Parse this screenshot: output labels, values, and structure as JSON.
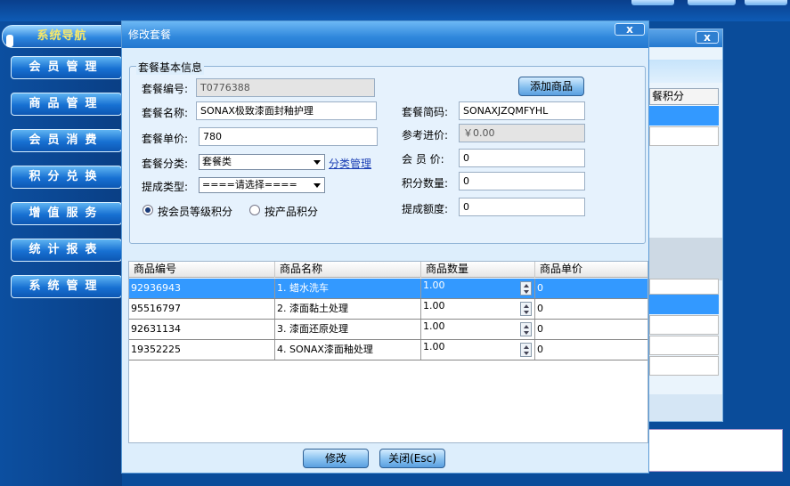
{
  "sidebar": {
    "header": "系统导航",
    "items": [
      {
        "label": "会员管理"
      },
      {
        "label": "商品管理"
      },
      {
        "label": "会员消费"
      },
      {
        "label": "积分兑换"
      },
      {
        "label": "增值服务"
      },
      {
        "label": "统计报表"
      },
      {
        "label": "系统管理"
      }
    ]
  },
  "background_window": {
    "close_glyph": "x",
    "column_header": "餐积分"
  },
  "dialog": {
    "title": "修改套餐",
    "close_glyph": "x",
    "section_title": "套餐基本信息",
    "fields": {
      "code_label": "套餐编号:",
      "code_value": "T0776388",
      "name_label": "套餐名称:",
      "name_value": "SONAX极致漆面封釉护理",
      "price_label": "套餐单价:",
      "price_value": "780",
      "category_label": "套餐分类:",
      "category_value": "套餐类",
      "category_link": "分类管理",
      "commission_type_label": "提成类型:",
      "commission_type_value": "====请选择====",
      "radio_member_level": "按会员等级积分",
      "radio_product": "按产品积分",
      "abbr_label": "套餐简码:",
      "abbr_value": "SONAXJZQMFYHL",
      "ref_price_label": "参考进价:",
      "ref_price_value": "￥0.00",
      "member_price_label": "会 员 价:",
      "member_price_value": "0",
      "points_label": "积分数量:",
      "points_value": "0",
      "commission_label": "提成额度:",
      "commission_value": "0"
    },
    "add_product_button": "添加商品",
    "table": {
      "columns": [
        "商品编号",
        "商品名称",
        "商品数量",
        "商品单价"
      ],
      "rows": [
        {
          "code": "92936943",
          "name": "1. 蜡水洗车",
          "qty": "1.00",
          "price": "0"
        },
        {
          "code": "95516797",
          "name": "2. 漆面黏土处理",
          "qty": "1.00",
          "price": "0"
        },
        {
          "code": "92631134",
          "name": "3. 漆面还原处理",
          "qty": "1.00",
          "price": "0"
        },
        {
          "code": "19352225",
          "name": "4. SONAX漆面釉处理",
          "qty": "1.00",
          "price": "0"
        }
      ]
    },
    "modify_button": "修改",
    "close_button": "关闭(Esc)"
  }
}
